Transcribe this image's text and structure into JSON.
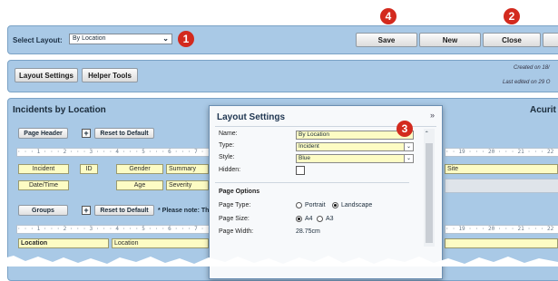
{
  "toolbar": {
    "select_layout_label": "Select Layout:",
    "layout_value": "By Location",
    "save": "Save",
    "new": "New",
    "close": "Close"
  },
  "tools": {
    "layout_settings": "Layout Settings",
    "helper_tools": "Helper Tools",
    "created_on": "Created on 18/",
    "last_edited": "Last edited on 29 O"
  },
  "report": {
    "title": "Incidents by Location",
    "right_title": "Acurit",
    "page_header_btn": "Page Header",
    "reset_default": "Reset to Default",
    "ruler1": "· · · 1 · · · 2 · · · 3 · · · 4 · · · 5 · · · 6 · · · 7 · · ·",
    "ruler1_right": "· · 19 · · · 20 · · · 21 · · · 22 · ·",
    "fields_row1": [
      "Incident",
      "ID",
      "Gender",
      "Summary"
    ],
    "fields_row2": [
      "Date/Time",
      "Age",
      "Severity"
    ],
    "site": "Site",
    "groups_btn": "Groups",
    "reset_default2": "Reset to Default",
    "note": "* Please note: Th",
    "ruler2": "· · · 1 · · · 2 · · · 3 · · · 4 · · · 5 · · · 6 · · · 7 · · ·",
    "ruler2_right": "· · 19 · · · 20 · · · 21 · · · 22 · ·",
    "location_a": "Location",
    "location_b": "Location"
  },
  "dialog": {
    "title": "Layout Settings",
    "name_label": "Name:",
    "name_value": "By Location",
    "type_label": "Type:",
    "type_value": "Incident",
    "style_label": "Style:",
    "style_value": "Blue",
    "hidden_label": "Hidden:",
    "page_options": "Page Options",
    "page_type_label": "Page Type:",
    "portrait": "Portrait",
    "landscape": "Landscape",
    "page_size_label": "Page Size:",
    "a4": "A4",
    "a3": "A3",
    "page_width_label": "Page Width:",
    "page_width_value": "28.75cm"
  },
  "badges": {
    "b1": "1",
    "b2": "2",
    "b3": "3",
    "b4": "4"
  },
  "colors": {
    "badge": "#d32a1e",
    "panel": "#a9c9e6",
    "field": "#fdfcc4"
  }
}
